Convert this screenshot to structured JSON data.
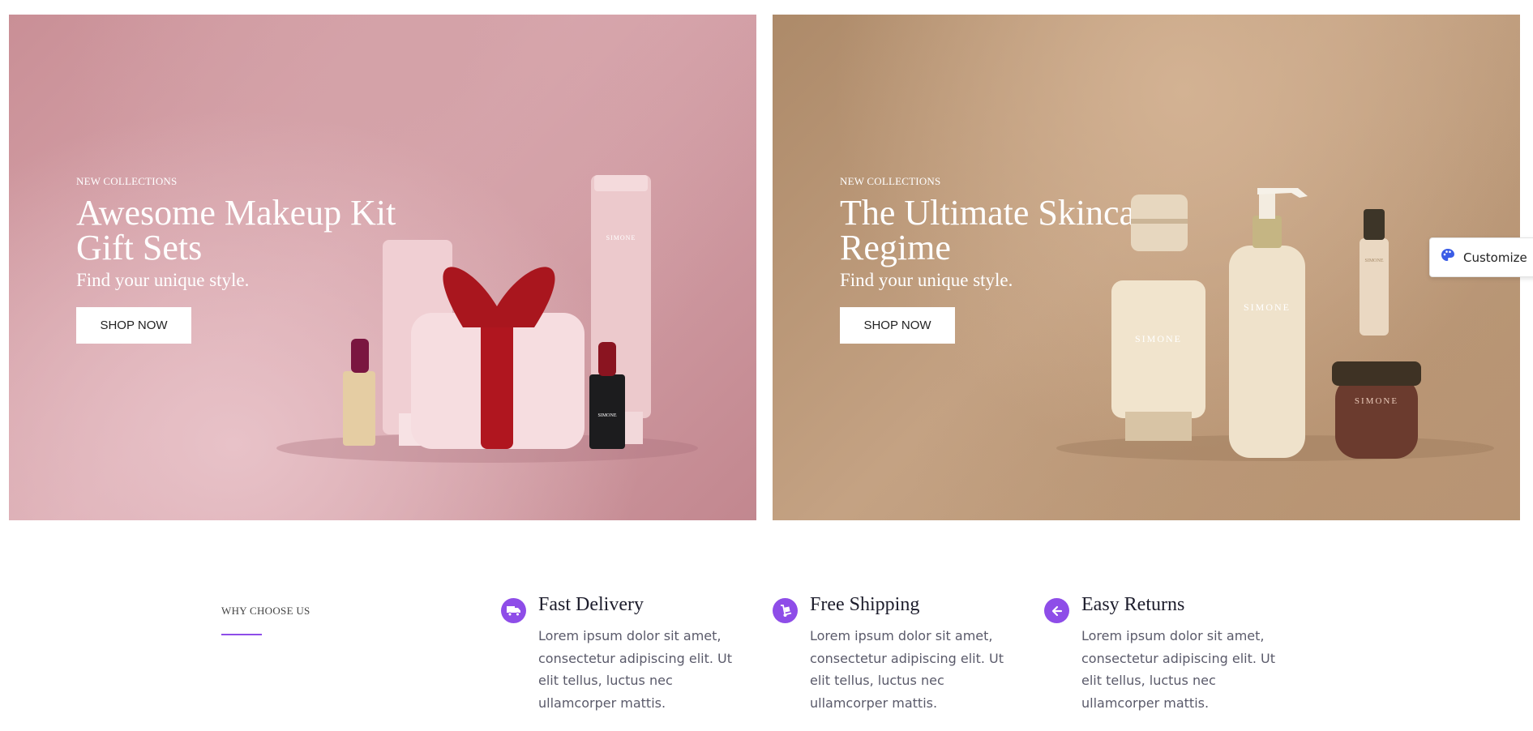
{
  "banners": [
    {
      "eyebrow": "NEW COLLECTIONS",
      "headline": "Awesome Makeup Kit Gift Sets",
      "subtitle": "Find your unique style.",
      "button": "SHOP NOW"
    },
    {
      "eyebrow": "NEW COLLECTIONS",
      "headline": "The Ultimate Skincare Regime",
      "subtitle": "Find your unique style.",
      "button": "SHOP NOW"
    }
  ],
  "product_brand": "SIMONE",
  "customize": {
    "label": "Customize",
    "icon": "palette-icon"
  },
  "why": {
    "label": "WHY CHOOSE US",
    "accent": "#8e4de8"
  },
  "features": [
    {
      "icon": "truck-icon",
      "title": "Fast Delivery",
      "description": "Lorem ipsum dolor sit amet, consectetur adipiscing elit. Ut elit tellus, luctus nec ullamcorper mattis."
    },
    {
      "icon": "hand-truck-icon",
      "title": "Free Shipping",
      "description": "Lorem ipsum dolor sit amet, consectetur adipiscing elit. Ut elit tellus, luctus nec ullamcorper mattis."
    },
    {
      "icon": "arrow-left-icon",
      "title": "Easy Returns",
      "description": "Lorem ipsum dolor sit amet, consectetur adipiscing elit. Ut elit tellus, luctus nec ullamcorper mattis."
    }
  ]
}
